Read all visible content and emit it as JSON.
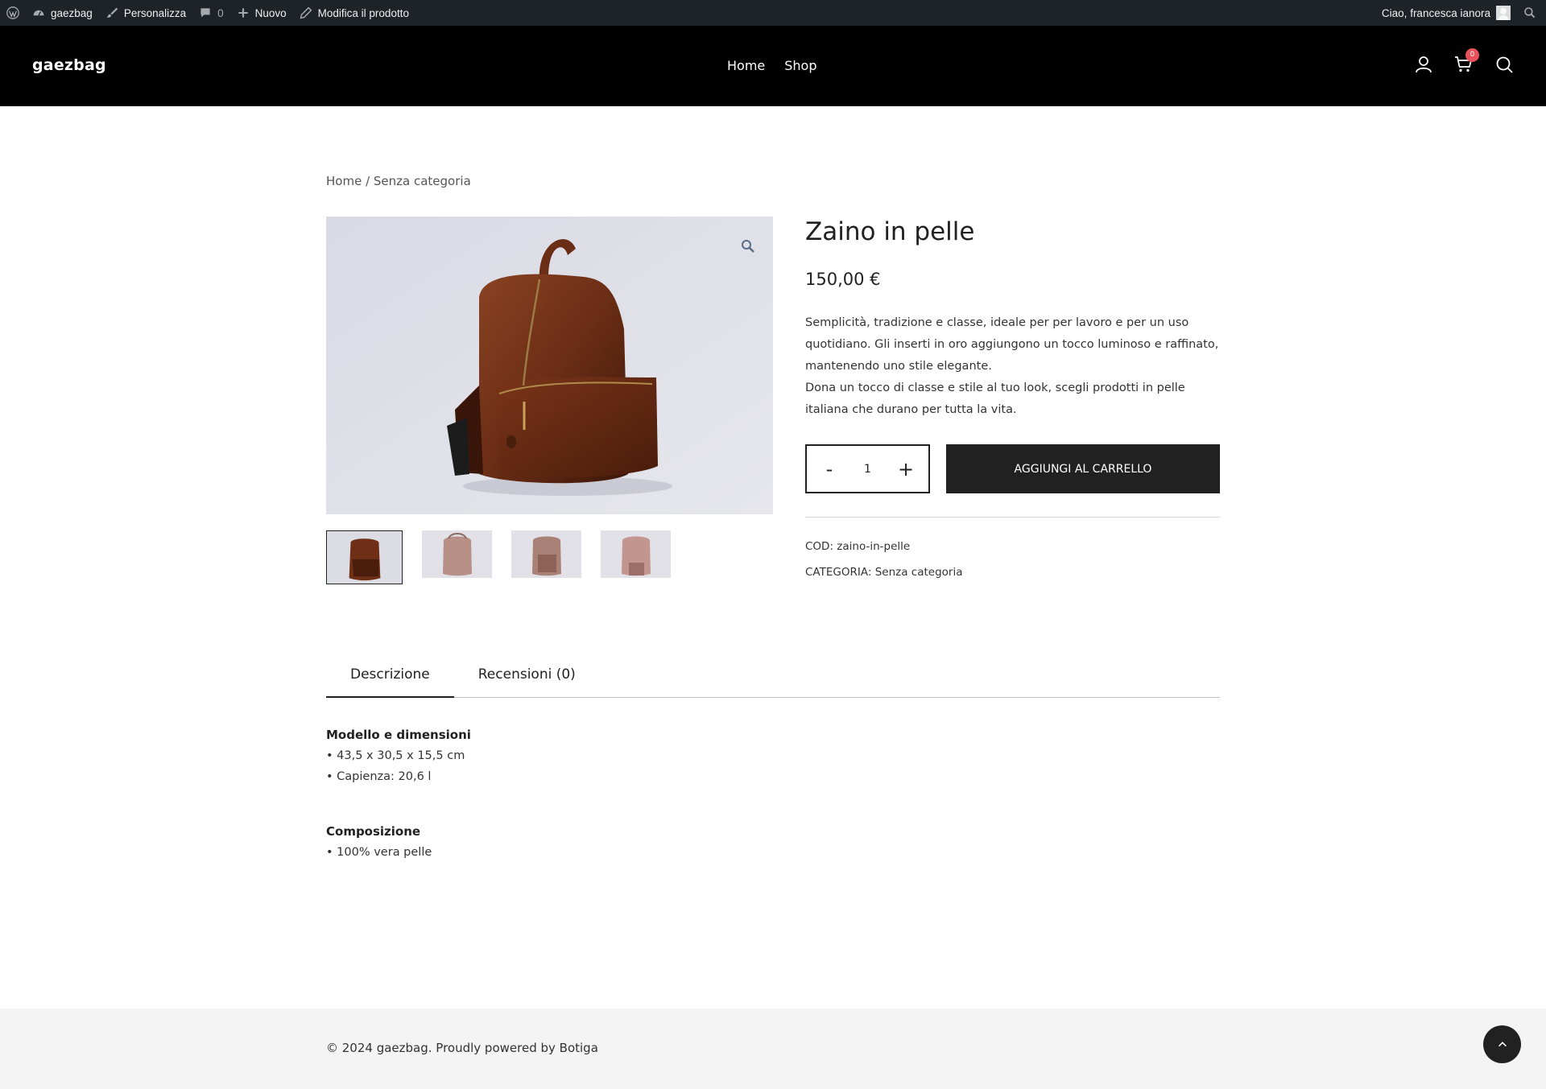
{
  "admin_bar": {
    "site_name": "gaezbag",
    "customize": "Personalizza",
    "comments_count": "0",
    "new": "Nuovo",
    "edit_product": "Modifica il prodotto",
    "greeting": "Ciao, francesca ianora"
  },
  "header": {
    "site_title": "gaezbag",
    "nav": [
      "Home",
      "Shop"
    ],
    "cart_count": "0"
  },
  "breadcrumb": {
    "home": "Home",
    "separator": " / ",
    "current": "Senza categoria"
  },
  "product": {
    "title": "Zaino in pelle",
    "price": "150,00 €",
    "description_lines": [
      "Semplicità, tradizione e classe, ideale per per lavoro e per un uso quotidiano. Gli inserti in oro aggiungono un tocco luminoso e raffinato, mantenendo uno stile elegante.",
      "Dona un tocco di classe e stile al tuo look, scegli prodotti in pelle italiana che durano per tutta la vita."
    ],
    "quantity": "1",
    "minus": "-",
    "plus": "+",
    "add_to_cart": "AGGIUNGI AL CARRELLO",
    "sku_label": "COD:",
    "sku": "zaino-in-pelle",
    "category_label": "CATEGORIA:",
    "category": "Senza categoria",
    "thumbnail_count": 4
  },
  "tabs": {
    "items": [
      "Descrizione",
      "Recensioni (0)"
    ],
    "active": "Descrizione"
  },
  "description": {
    "section1_title": "Modello e dimensioni",
    "section1_items": [
      "• 43,5 x 30,5 x 15,5 cm",
      "• Capienza: 20,6 l"
    ],
    "section2_title": "Composizione",
    "section2_items": [
      "• 100% vera pelle"
    ]
  },
  "footer": {
    "text": "© 2024 gaezbag. Proudly powered by Botiga"
  },
  "colors": {
    "admin_bar": "#1d2327",
    "header": "#000000",
    "accent_dark": "#212121",
    "cart_badge": "#e8515a",
    "footer_bg": "#f4f4f4"
  }
}
